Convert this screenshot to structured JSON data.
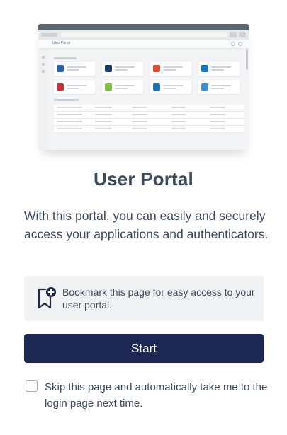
{
  "preview": {
    "header_title": "User Portal",
    "apps": [
      {
        "icon": "circle-app-icon",
        "color": "#2f5ea8"
      },
      {
        "icon": "v-app-icon",
        "color": "#1e3b6b"
      },
      {
        "icon": "multicolor-app-icon",
        "color": "#e04e39"
      },
      {
        "icon": "box-app-icon",
        "color": "#1a73c9"
      },
      {
        "icon": "red-app-icon",
        "color": "#d12e3c"
      },
      {
        "icon": "green-app-icon",
        "color": "#7fbf3f"
      },
      {
        "icon": "blue-app-icon",
        "color": "#1d6fb8"
      },
      {
        "icon": "cloud-app-icon",
        "color": "#3a8fd6"
      }
    ]
  },
  "title": "User Portal",
  "description": "With this portal, you can easily and securely access your applications and authenticators.",
  "bookmark": {
    "icon": "bookmark-plus-icon",
    "text": "Bookmark this page for easy access to your user portal."
  },
  "start_label": "Start",
  "skip": {
    "checked": false,
    "label": "Skip this page and automatically take me to the login page next time."
  },
  "colors": {
    "primary_button": "#1c2853",
    "text": "#3e4a5b",
    "panel": "#f1f2f3"
  }
}
